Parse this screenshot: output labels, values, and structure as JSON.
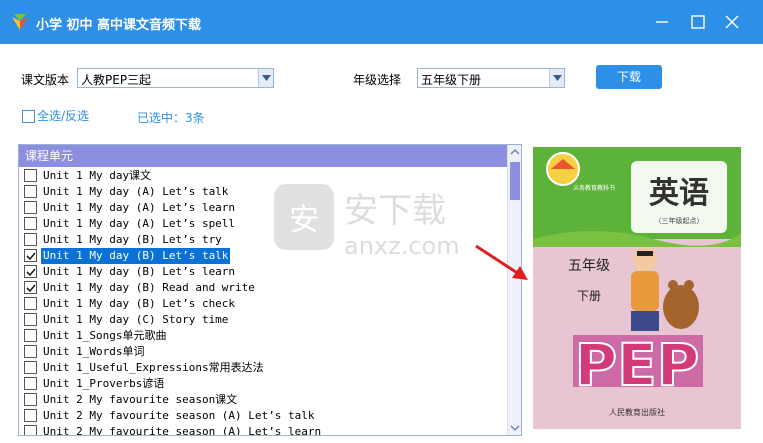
{
  "window": {
    "title": "小学 初中 高中课文音频下载",
    "icon": "app-logo-icon",
    "controls": [
      "minimize-icon",
      "maximize-icon",
      "close-icon"
    ]
  },
  "toolbar": {
    "edition_label": "课文版本",
    "edition_value": "人教PEP三起",
    "grade_label": "年级选择",
    "grade_value": "五年级下册",
    "download_label": "下载"
  },
  "selection": {
    "select_all_label": "全选/反选",
    "selected_count_text": "已选中：3条"
  },
  "list": {
    "header": "课程单元",
    "items": [
      {
        "label": "Unit 1 My day课文",
        "checked": false,
        "selected": false
      },
      {
        "label": "Unit 1 My day (A) Let’s talk",
        "checked": false,
        "selected": false
      },
      {
        "label": "Unit 1 My day (A) Let’s learn",
        "checked": false,
        "selected": false
      },
      {
        "label": "Unit 1 My day (A) Let’s spell",
        "checked": false,
        "selected": false
      },
      {
        "label": "Unit 1 My day (B) Let’s try",
        "checked": false,
        "selected": false
      },
      {
        "label": "Unit 1 My day (B) Let’s talk",
        "checked": true,
        "selected": true
      },
      {
        "label": "Unit 1 My day (B) Let’s learn",
        "checked": true,
        "selected": false
      },
      {
        "label": "Unit 1 My day (B) Read and write",
        "checked": true,
        "selected": false
      },
      {
        "label": "Unit 1 My day (B) Let’s check",
        "checked": false,
        "selected": false
      },
      {
        "label": "Unit 1 My day (C) Story time",
        "checked": false,
        "selected": false
      },
      {
        "label": "Unit 1_Songs单元歌曲",
        "checked": false,
        "selected": false
      },
      {
        "label": "Unit 1_Words单词",
        "checked": false,
        "selected": false
      },
      {
        "label": "Unit 1_Useful_Expressions常用表达法",
        "checked": false,
        "selected": false
      },
      {
        "label": "Unit 1_Proverbs谚语",
        "checked": false,
        "selected": false
      },
      {
        "label": "Unit 2 My favourite season课文",
        "checked": false,
        "selected": false
      },
      {
        "label": "Unit 2 My favourite season (A) Let’s talk",
        "checked": false,
        "selected": false
      },
      {
        "label": "Unit 2 My favourite season (A) Let’s learn",
        "checked": false,
        "selected": false
      }
    ]
  },
  "cover": {
    "subject": "英语",
    "subtitle": "（三年级起点）",
    "top_badge": "义务教育教科书",
    "grade": "五年级",
    "term": "下册",
    "series": "PEP",
    "publisher": "人民教育出版社"
  },
  "watermark": {
    "cn": "安下载",
    "en": "anxz.com"
  },
  "colors": {
    "titlebar": "#2d8fe6",
    "list_header": "#8c8ee0",
    "selected_row": "#0a72d6",
    "cover_green": "#5db33a",
    "cover_pink": "#e7c5d2",
    "arrow_red": "#e02020"
  }
}
